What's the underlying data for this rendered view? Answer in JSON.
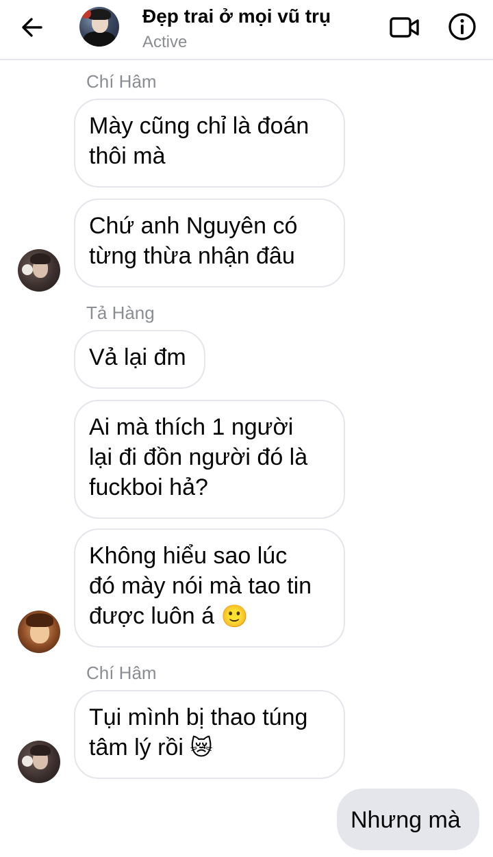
{
  "header": {
    "back_icon": "arrow-left-icon",
    "title": "Đẹp trai ở mọi vũ trụ",
    "status": "Active",
    "video_icon": "video-camera-icon",
    "info_icon": "info-icon"
  },
  "messages": {
    "sender_1": "Chí Hâm",
    "bubble_1": {
      "lines": [
        "Mày cũng chỉ là đoán",
        "thôi mà"
      ]
    },
    "bubble_2": {
      "lines": [
        "Chứ anh Nguyên có",
        "từng thừa nhận đâu"
      ]
    },
    "sender_2": "Tả Hàng",
    "bubble_3": {
      "lines": [
        "Vả lại đm"
      ]
    },
    "bubble_4": {
      "lines": [
        "Ai mà thích 1 người",
        "lại đi đồn người đó là",
        "fuckboi hả?"
      ]
    },
    "bubble_5": {
      "lines": [
        "Không hiểu sao lúc",
        "đó mày nói mà tao tin",
        "được luôn á"
      ],
      "emoji": "🙂"
    },
    "sender_3": "Chí Hâm",
    "bubble_6": {
      "lines": [
        "Tụi mình bị thao túng",
        "tâm lý rồi"
      ],
      "emoji": "😿"
    },
    "outgoing_1": "Nhưng mà"
  },
  "colors": {
    "incoming_border": "#e4e6eb",
    "outgoing_bg": "#e4e6eb",
    "secondary_text": "#8a8d91",
    "primary_text": "#050505"
  }
}
